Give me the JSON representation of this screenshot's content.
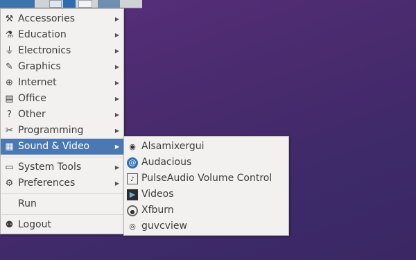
{
  "menu": {
    "items": [
      {
        "label": "Accessories",
        "icon": "accessories-icon"
      },
      {
        "label": "Education",
        "icon": "education-icon"
      },
      {
        "label": "Electronics",
        "icon": "electronics-icon"
      },
      {
        "label": "Graphics",
        "icon": "graphics-icon"
      },
      {
        "label": "Internet",
        "icon": "internet-icon"
      },
      {
        "label": "Office",
        "icon": "office-icon"
      },
      {
        "label": "Other",
        "icon": "other-icon"
      },
      {
        "label": "Programming",
        "icon": "programming-icon"
      },
      {
        "label": "Sound & Video",
        "icon": "sound-video-icon"
      },
      {
        "label": "System Tools",
        "icon": "system-tools-icon"
      },
      {
        "label": "Preferences",
        "icon": "preferences-icon"
      },
      {
        "label": "Run"
      },
      {
        "label": "Logout",
        "icon": "logout-icon"
      }
    ],
    "highlight_color": "#4a78b3"
  },
  "submenu": {
    "items": [
      {
        "label": "Alsamixergui",
        "icon": "alsamixer-icon"
      },
      {
        "label": "Audacious",
        "icon": "audacious-icon"
      },
      {
        "label": "PulseAudio Volume Control",
        "icon": "pulseaudio-icon"
      },
      {
        "label": "Videos",
        "icon": "videos-icon"
      },
      {
        "label": "Xfburn",
        "icon": "xfburn-icon"
      },
      {
        "label": "guvcview",
        "icon": "webcam-icon"
      }
    ]
  },
  "colors": {
    "desktop": "#4a2b6e",
    "menu_bg": "#f2f1f0",
    "text": "#3c3c3c"
  }
}
